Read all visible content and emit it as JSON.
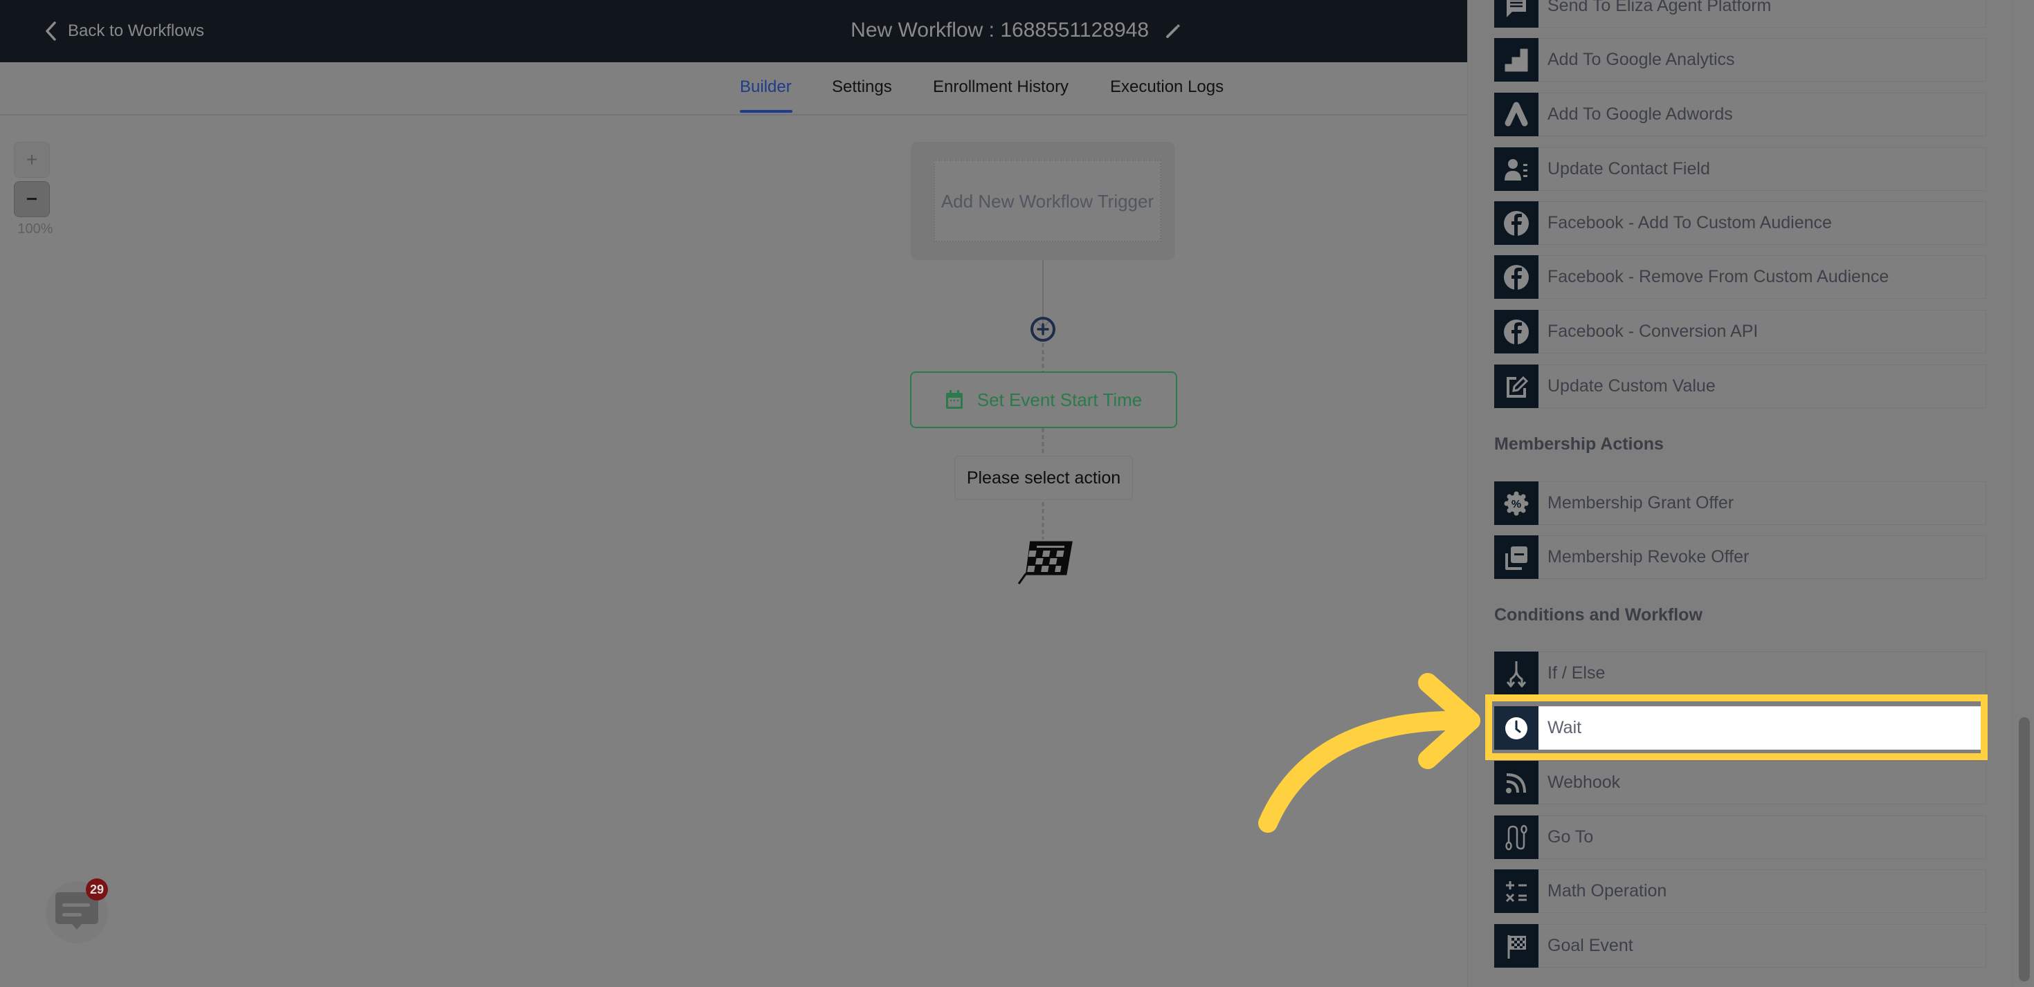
{
  "header": {
    "back_label": "Back to Workflows",
    "workflow_title": "New Workflow : 1688551128948"
  },
  "tabs": [
    {
      "label": "Builder",
      "active": true
    },
    {
      "label": "Settings",
      "active": false
    },
    {
      "label": "Enrollment History",
      "active": false
    },
    {
      "label": "Execution Logs",
      "active": false
    }
  ],
  "zoom": {
    "in_label": "+",
    "out_label": "−",
    "level": "100%"
  },
  "canvas": {
    "trigger_label": "Add New Workflow Trigger",
    "action_node_label": "Set Event Start Time",
    "placeholder_node_label": "Please select action"
  },
  "chat": {
    "unread_count": "29"
  },
  "panel": {
    "top_items": [
      {
        "label": "Send To Eliza Agent Platform",
        "icon": "chat-lines-icon"
      },
      {
        "label": "Add To Google Analytics",
        "icon": "google-analytics-icon"
      },
      {
        "label": "Add To Google Adwords",
        "icon": "google-ads-icon"
      },
      {
        "label": "Update Contact Field",
        "icon": "contact-field-icon"
      },
      {
        "label": "Facebook - Add To Custom Audience",
        "icon": "facebook-icon"
      },
      {
        "label": "Facebook - Remove From Custom Audience",
        "icon": "facebook-icon"
      },
      {
        "label": "Facebook - Conversion API",
        "icon": "facebook-icon"
      },
      {
        "label": "Update Custom Value",
        "icon": "edit-square-icon"
      }
    ],
    "membership": {
      "heading": "Membership Actions",
      "items": [
        {
          "label": "Membership Grant Offer",
          "icon": "discount-badge-icon"
        },
        {
          "label": "Membership Revoke Offer",
          "icon": "remove-copy-icon"
        }
      ]
    },
    "conditions": {
      "heading": "Conditions and Workflow",
      "items": [
        {
          "label": "If / Else",
          "icon": "split-icon"
        },
        {
          "label": "Wait",
          "icon": "clock-icon",
          "highlighted": true
        },
        {
          "label": "Webhook",
          "icon": "rss-icon"
        },
        {
          "label": "Go To",
          "icon": "route-icon"
        },
        {
          "label": "Math Operation",
          "icon": "calculator-icon"
        },
        {
          "label": "Goal Event",
          "icon": "goal-flag-icon"
        }
      ]
    }
  },
  "colors": {
    "highlight": "#ffd140",
    "tab_active": "#1e3c8a",
    "action_node": "#2a7a4c",
    "badge": "#7a1414"
  }
}
